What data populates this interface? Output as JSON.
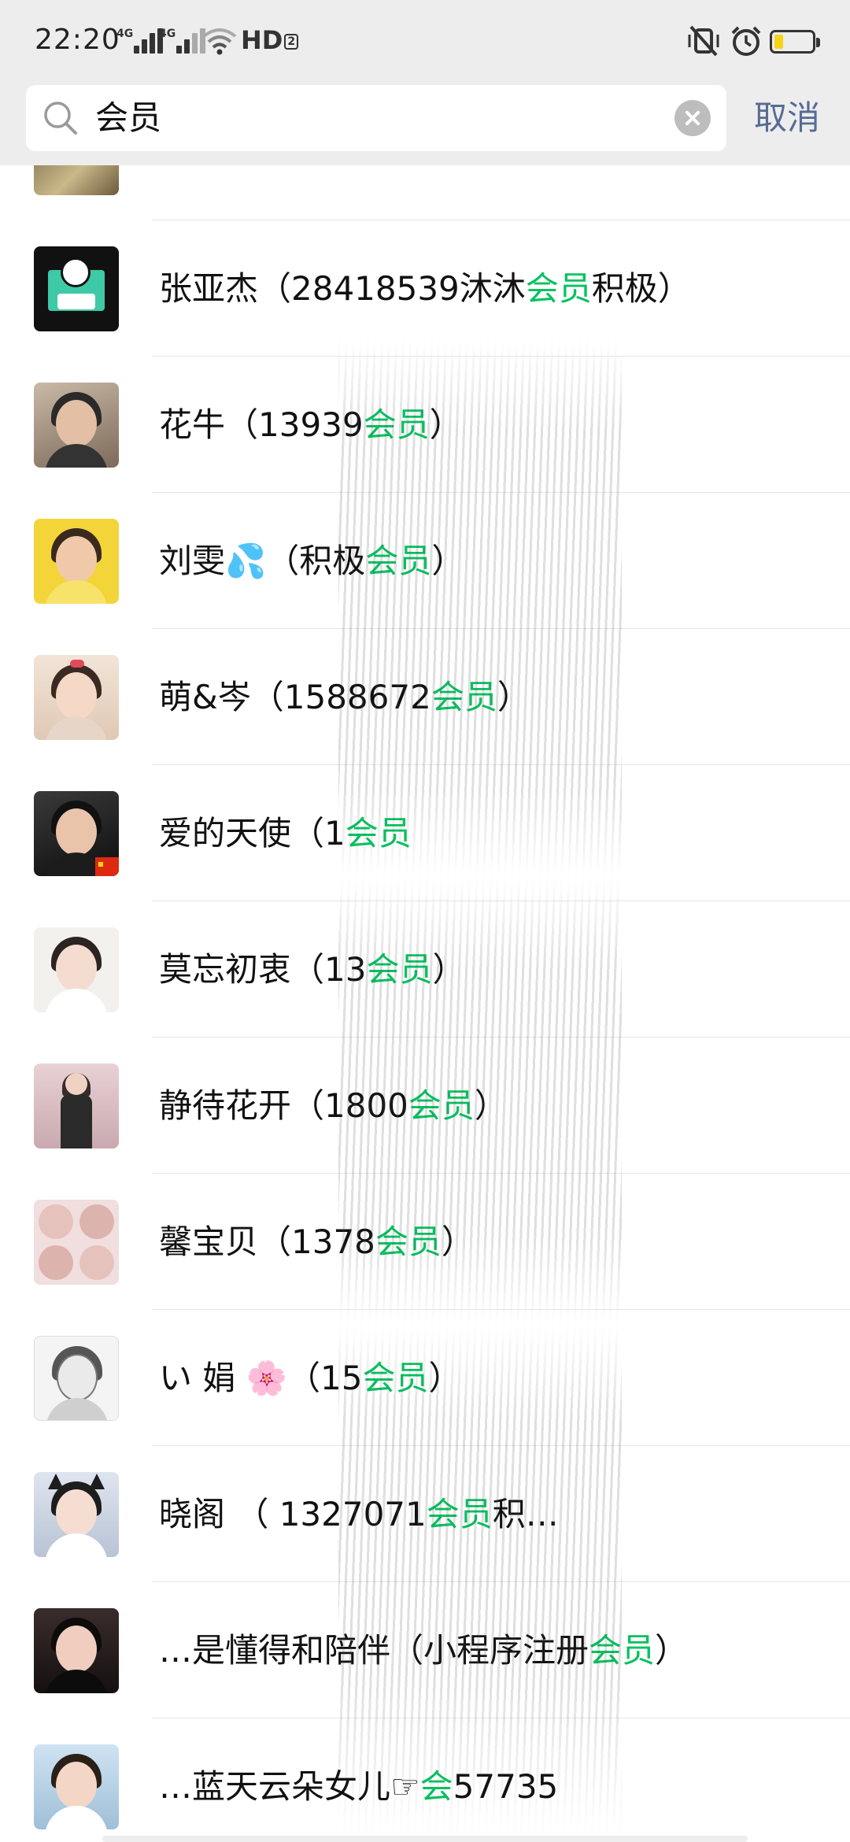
{
  "status_bar": {
    "time": "22:20",
    "signal1_label": "4G",
    "signal2_label": "4G",
    "hd_label": "HD",
    "hd_sub": "2"
  },
  "search": {
    "query": "会员",
    "cancel_label": "取消"
  },
  "results": [
    {
      "name_prefix": "",
      "highlight": "",
      "name_suffix": "",
      "avatar": "beige"
    },
    {
      "name_prefix": "张亚杰（28418539沐沐",
      "highlight": "会员",
      "name_suffix": "积极）",
      "avatar": "cartoon"
    },
    {
      "name_prefix": "花牛（13939",
      "highlight": "会员",
      "name_suffix": "）",
      "avatar": "man"
    },
    {
      "name_prefix": "刘雯💦（积极",
      "highlight": "会员",
      "name_suffix": "）",
      "avatar": "yellow"
    },
    {
      "name_prefix": "萌&岑（1588672",
      "highlight": "会员",
      "name_suffix": "）",
      "avatar": "child"
    },
    {
      "name_prefix": "爱的天使（1",
      "highlight": "会员",
      "name_suffix": "",
      "avatar": "woman-dark"
    },
    {
      "name_prefix": "莫忘初衷（13",
      "highlight": "会员",
      "name_suffix": "）",
      "avatar": "woman-light"
    },
    {
      "name_prefix": "静待花开（1800",
      "highlight": "会员",
      "name_suffix": "）",
      "avatar": "woman-pink"
    },
    {
      "name_prefix": "馨宝贝（1378",
      "highlight": "会员",
      "name_suffix": "）",
      "avatar": "collage"
    },
    {
      "name_prefix": "い 娟 🌸（15",
      "highlight": "会员",
      "name_suffix": "）",
      "avatar": "sketch"
    },
    {
      "name_prefix": "晓阁 （ 1327071",
      "highlight": "会员",
      "name_suffix": "积…",
      "avatar": "cat-girl"
    },
    {
      "name_prefix": "…是懂得和陪伴（小程序注册",
      "highlight": "会员",
      "name_suffix": "）",
      "avatar": "woman-black"
    },
    {
      "name_prefix": "…蓝天云朵女儿☞",
      "highlight": "会",
      "name_suffix": "57735",
      "avatar": "woman-white"
    }
  ],
  "colors": {
    "highlight": "#07c160",
    "cancel": "#576b95",
    "header_bg": "#ededed"
  },
  "icons": {
    "search": "search-icon",
    "clear": "clear-icon",
    "mute": "mute-vibrate-icon",
    "alarm": "alarm-icon",
    "battery": "battery-icon",
    "wifi": "wifi-icon"
  }
}
